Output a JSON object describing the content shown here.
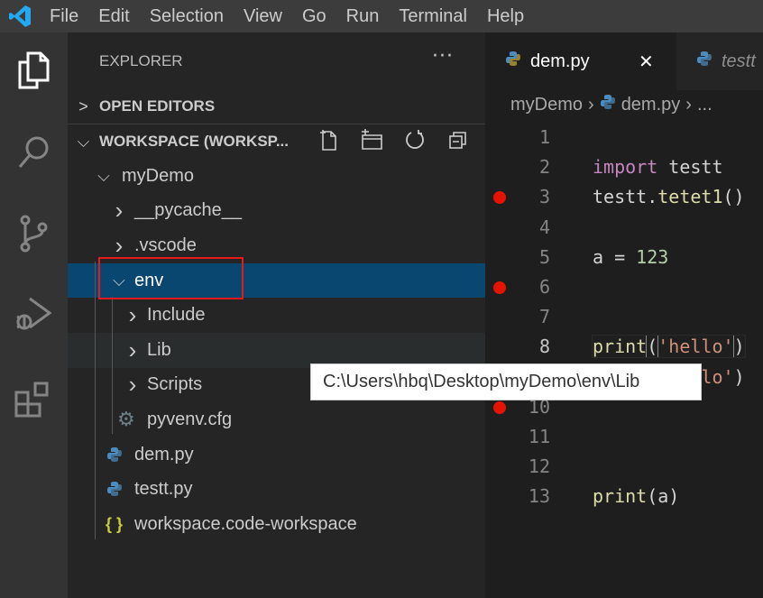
{
  "menubar": {
    "items": [
      "File",
      "Edit",
      "Selection",
      "View",
      "Go",
      "Run",
      "Terminal",
      "Help"
    ]
  },
  "activity_bar": {
    "items": [
      "explorer",
      "search",
      "source-control",
      "run-debug",
      "extensions"
    ]
  },
  "sidebar": {
    "title": "EXPLORER",
    "more": "···",
    "open_editors": "OPEN EDITORS",
    "workspace": "WORKSPACE (WORKSP...",
    "tree": [
      {
        "label": "myDemo",
        "type": "folder",
        "expanded": true,
        "depth": 0
      },
      {
        "label": "__pycache__",
        "type": "folder",
        "expanded": false,
        "depth": 1
      },
      {
        "label": ".vscode",
        "type": "folder",
        "expanded": false,
        "depth": 1
      },
      {
        "label": "env",
        "type": "folder",
        "expanded": true,
        "depth": 1,
        "selected": true
      },
      {
        "label": "Include",
        "type": "folder",
        "expanded": false,
        "depth": 2
      },
      {
        "label": "Lib",
        "type": "folder",
        "expanded": false,
        "depth": 2,
        "hover": true
      },
      {
        "label": "Scripts",
        "type": "folder",
        "expanded": false,
        "depth": 2
      },
      {
        "label": "pyvenv.cfg",
        "type": "cfg",
        "depth": 2
      },
      {
        "label": "dem.py",
        "type": "python",
        "depth": 1
      },
      {
        "label": "testt.py",
        "type": "python",
        "depth": 1
      },
      {
        "label": "workspace.code-workspace",
        "type": "json",
        "depth": 1
      }
    ]
  },
  "tabs": [
    {
      "label": "dem.py",
      "active": true,
      "close": "✕"
    },
    {
      "label": "testt",
      "active": false
    }
  ],
  "breadcrumb": [
    "myDemo",
    "dem.py",
    "..."
  ],
  "editor": {
    "lines": [
      {
        "n": "1",
        "code": ""
      },
      {
        "n": "2",
        "code": "import testt"
      },
      {
        "n": "3",
        "code": "testt.tetet1()",
        "breakpoint": true
      },
      {
        "n": "4",
        "code": ""
      },
      {
        "n": "5",
        "code": "a = 123"
      },
      {
        "n": "6",
        "code": "",
        "breakpoint": true
      },
      {
        "n": "7",
        "code": ""
      },
      {
        "n": "8",
        "code": "print('hello')",
        "current": true
      },
      {
        "n": "9",
        "code": "print('hello')"
      },
      {
        "n": "10",
        "code": "",
        "breakpoint": true
      },
      {
        "n": "11",
        "code": ""
      },
      {
        "n": "12",
        "code": ""
      },
      {
        "n": "13",
        "code": "print(a)"
      }
    ]
  },
  "tooltip": "C:\\Users\\hbq\\Desktop\\myDemo\\env\\Lib",
  "colors": {
    "selection": "#094771",
    "breakpoint": "#e51400",
    "annotation": "#e51a1a",
    "accent": "#0078d4"
  }
}
